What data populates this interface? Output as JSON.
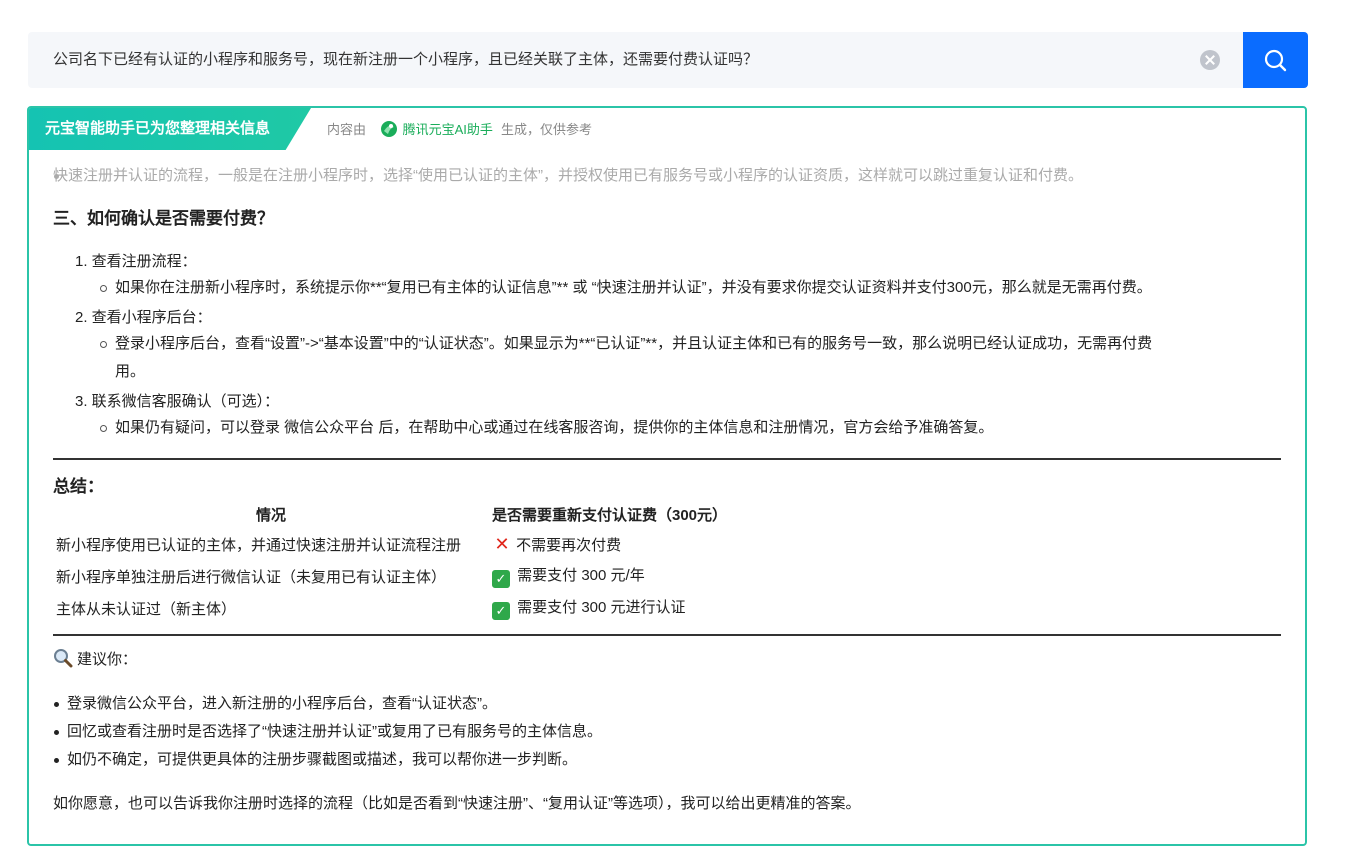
{
  "search": {
    "query": "公司名下已经有认证的小程序和服务号，现在新注册一个小程序，且已经关联了主体，还需要付费认证吗？"
  },
  "panel": {
    "tag": "元宝智能助手已为您整理相关信息",
    "source_prefix": "内容由",
    "source_name": "腾讯元宝AI助手",
    "source_suffix": "生成，仅供参考",
    "accent_color": "#2bc4a8"
  },
  "answer": {
    "faded_bullet": "快速注册并认证的流程，一般是在注册小程序时，选择“使用已认证的主体”，并授权使用已有服务号或小程序的认证资质，这样就可以跳过重复认证和付费。",
    "section_title": "三、如何确认是否需要付费？",
    "steps": [
      {
        "label": "1. 查看注册流程：",
        "subs": [
          "如果你在注册新小程序时，系统提示你**“复用已有主体的认证信息”** 或 “快速注册并认证”，并没有要求你提交认证资料并支付300元，那么就是无需再付费。"
        ]
      },
      {
        "label": "2. 查看小程序后台：",
        "subs": [
          "登录小程序后台，查看“设置”->“基本设置”中的“认证状态”。如果显示为**“已认证”**，并且认证主体和已有的服务号一致，那么说明已经认证成功，无需再付费",
          "用。"
        ]
      },
      {
        "label": "3. 联系微信客服确认（可选）：",
        "subs": [
          "如果仍有疑问，可以登录 微信公众平台 后，在帮助中心或通过在线客服咨询，提供你的主体信息和注册情况，官方会给予准确答复。"
        ]
      }
    ],
    "summary_title": "总结：",
    "table": {
      "headers": [
        "情况",
        "是否需要重新支付认证费（300元）"
      ],
      "rows": [
        {
          "situation": "新小程序使用已认证的主体，并通过快速注册并认证流程注册",
          "icon": "cross-mark-icon",
          "result": "不需要再次付费"
        },
        {
          "situation": "新小程序单独注册后进行微信认证（未复用已有认证主体）",
          "icon": "check-mark-icon",
          "result": "需要支付 300 元/年"
        },
        {
          "situation": "主体从未认证过（新主体）",
          "icon": "check-mark-icon",
          "result": "需要支付 300 元进行认证"
        }
      ]
    },
    "suggest_title": "建议你：",
    "suggestions": [
      "登录微信公众平台，进入新注册的小程序后台，查看“认证状态”。",
      "回忆或查看注册时是否选择了“快速注册并认证”或复用了已有服务号的主体信息。",
      "如仍不确定，可提供更具体的注册步骤截图或描述，我可以帮你进一步判断。"
    ],
    "closing": "如你愿意，也可以告诉我你注册时选择的流程（比如是否看到“快速注册”、“复用认证”等选项），我可以给出更精准的答案。"
  }
}
